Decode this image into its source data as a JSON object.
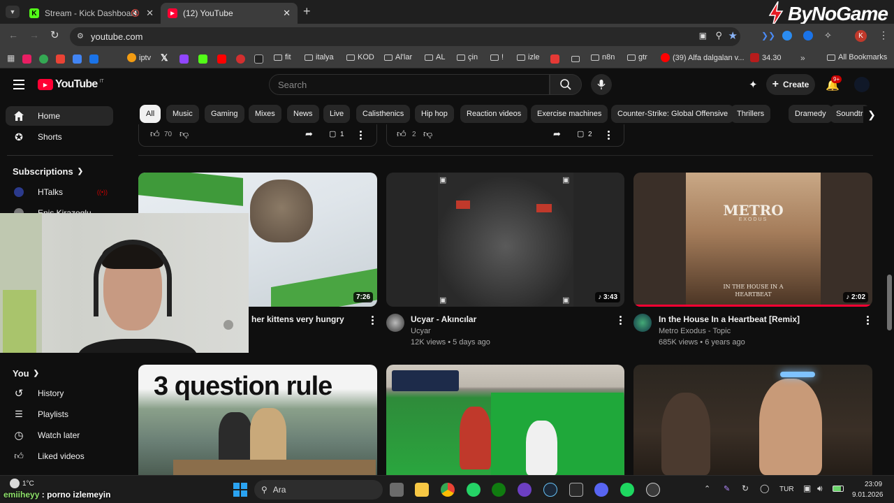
{
  "browser": {
    "tabs": [
      {
        "title": "Stream - Kick Dashboard",
        "active": false
      },
      {
        "title": "(12) YouTube",
        "active": true
      }
    ],
    "url": "youtube.com",
    "bookmarks": [
      "iptv",
      "fit",
      "italya",
      "KOD",
      "Al'lar",
      "AL",
      "çin",
      "!",
      "izle",
      "n8n",
      "gtr",
      "(39) Alfa dalgalan v...",
      "34.30"
    ],
    "all_bookmarks": "All Bookmarks",
    "profile_initial": "K"
  },
  "watermark": "ByNoGame",
  "youtube": {
    "logo": "YouTube",
    "logo_region": "IT",
    "search_placeholder": "Search",
    "create_label": "Create",
    "notif_badge": "9+",
    "chips": [
      "All",
      "Music",
      "Gaming",
      "Mixes",
      "News",
      "Live",
      "Calisthenics",
      "Hip hop",
      "Reaction videos",
      "Exercise machines",
      "Counter-Strike: Global Offensive",
      "Thrillers",
      "Dramedy",
      "Soundtr"
    ],
    "sidebar": {
      "home": "Home",
      "shorts": "Shorts",
      "subscriptions": "Subscriptions",
      "subs": [
        "HTalks",
        "Enis Kirazoglu"
      ],
      "you": "You",
      "you_items": [
        "History",
        "Playlists",
        "Watch later",
        "Liked videos"
      ]
    },
    "posts": [
      {
        "likes": "70",
        "comments": "1"
      },
      {
        "likes": "2",
        "comments": "2"
      }
    ],
    "videos": [
      {
        "title": "her kittens very hungry",
        "channel": "",
        "views": "",
        "duration": "7:26"
      },
      {
        "title": "Ucyar - Akıncılar",
        "channel": "Ucyar",
        "views": "12K views • 5 days ago",
        "duration": "3:43"
      },
      {
        "title": "In the House In a Heartbeat [Remix]",
        "channel": "Metro Exodus - Topic",
        "views": "685K views • 6 years ago",
        "duration": "2:02"
      },
      {
        "title": "",
        "channel": "",
        "views": "",
        "duration": ""
      },
      {
        "title": "",
        "channel": "",
        "views": "",
        "duration": ""
      },
      {
        "title": "",
        "channel": "",
        "views": "",
        "duration": ""
      }
    ],
    "thumb_text": {
      "question": "3 question rule",
      "metro_title": "METRO",
      "metro_sub": "EXODUS",
      "metro_caption": "IN THE HOUSE IN A HEARTBEAT"
    }
  },
  "taskbar": {
    "weather": "1°C",
    "overlay_user": "emiiheyy",
    "overlay_msg": "porno izlemeyin",
    "search": "Ara",
    "lang": "TUR",
    "time": "23:09",
    "date": "9.01.2026"
  }
}
